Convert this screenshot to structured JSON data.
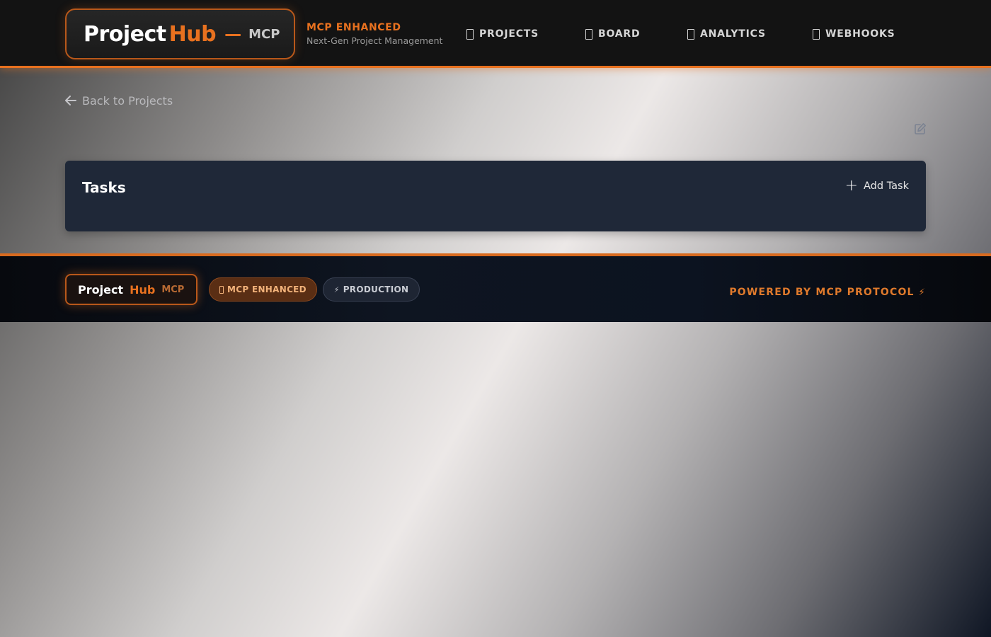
{
  "header": {
    "logo": {
      "project": "Project",
      "hub": "Hub",
      "dash": "—",
      "mcp": "MCP"
    },
    "tagline": {
      "title": "MCP ENHANCED",
      "subtitle": "Next-Gen Project Management"
    },
    "nav": [
      {
        "label": "PROJECTS",
        "icon": "projects-icon"
      },
      {
        "label": "BOARD",
        "icon": "board-icon"
      },
      {
        "label": "ANALYTICS",
        "icon": "analytics-icon"
      },
      {
        "label": "WEBHOOKS",
        "icon": "webhooks-icon"
      }
    ]
  },
  "main": {
    "back_label": "Back to Projects",
    "back_icon": "arrow-left-icon",
    "edit_icon": "edit-icon",
    "tasks": {
      "title": "Tasks",
      "add_label": "Add Task",
      "add_icon": "plus-icon"
    }
  },
  "footer": {
    "logo": {
      "project": "Project",
      "hub": "Hub",
      "mcp": "MCP"
    },
    "badges": [
      {
        "label": "MCP ENHANCED",
        "icon": "box-icon"
      },
      {
        "label": "PRODUCTION",
        "icon": "⚡"
      }
    ],
    "powered": {
      "label": "POWERED BY MCP PROTOCOL",
      "icon": "⚡"
    }
  },
  "colors": {
    "accent": "#e8711f",
    "header_bg": "#131313",
    "panel_bg": "#1f2838",
    "footer_bg": "#0e1521"
  }
}
